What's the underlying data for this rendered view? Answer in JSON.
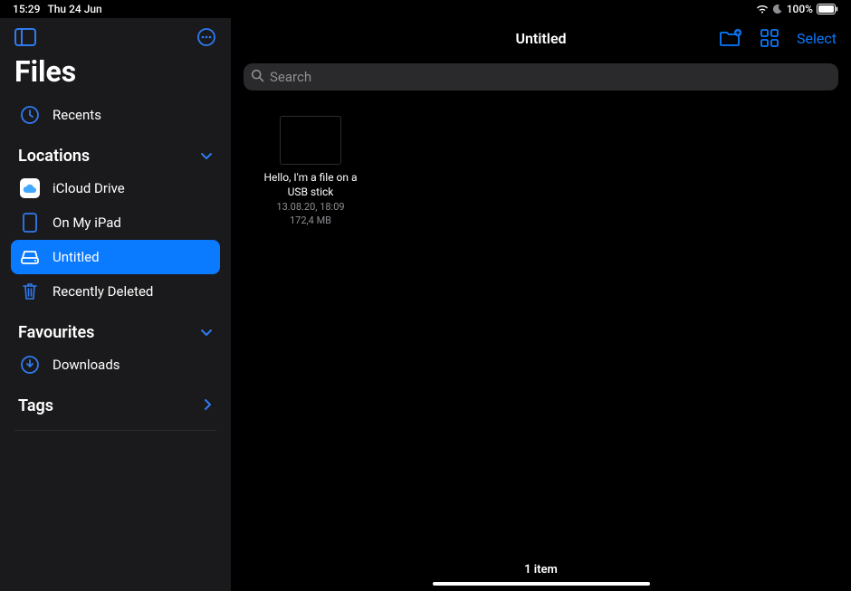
{
  "status": {
    "time": "15:29",
    "date": "Thu 24 Jun",
    "battery_pct": "100%"
  },
  "sidebar": {
    "title": "Files",
    "recents": "Recents",
    "sections": {
      "locations": {
        "label": "Locations",
        "items": [
          {
            "label": "iCloud Drive"
          },
          {
            "label": "On My iPad"
          },
          {
            "label": "Untitled"
          },
          {
            "label": "Recently Deleted"
          }
        ]
      },
      "favourites": {
        "label": "Favourites",
        "items": [
          {
            "label": "Downloads"
          }
        ]
      },
      "tags": {
        "label": "Tags"
      }
    }
  },
  "content": {
    "title": "Untitled",
    "select_label": "Select",
    "search_placeholder": "Search",
    "files": [
      {
        "name": "Hello, I'm a file on a USB stick",
        "date": "13.08.20, 18:09",
        "size": "172,4 MB"
      }
    ],
    "footer": "1 item"
  }
}
